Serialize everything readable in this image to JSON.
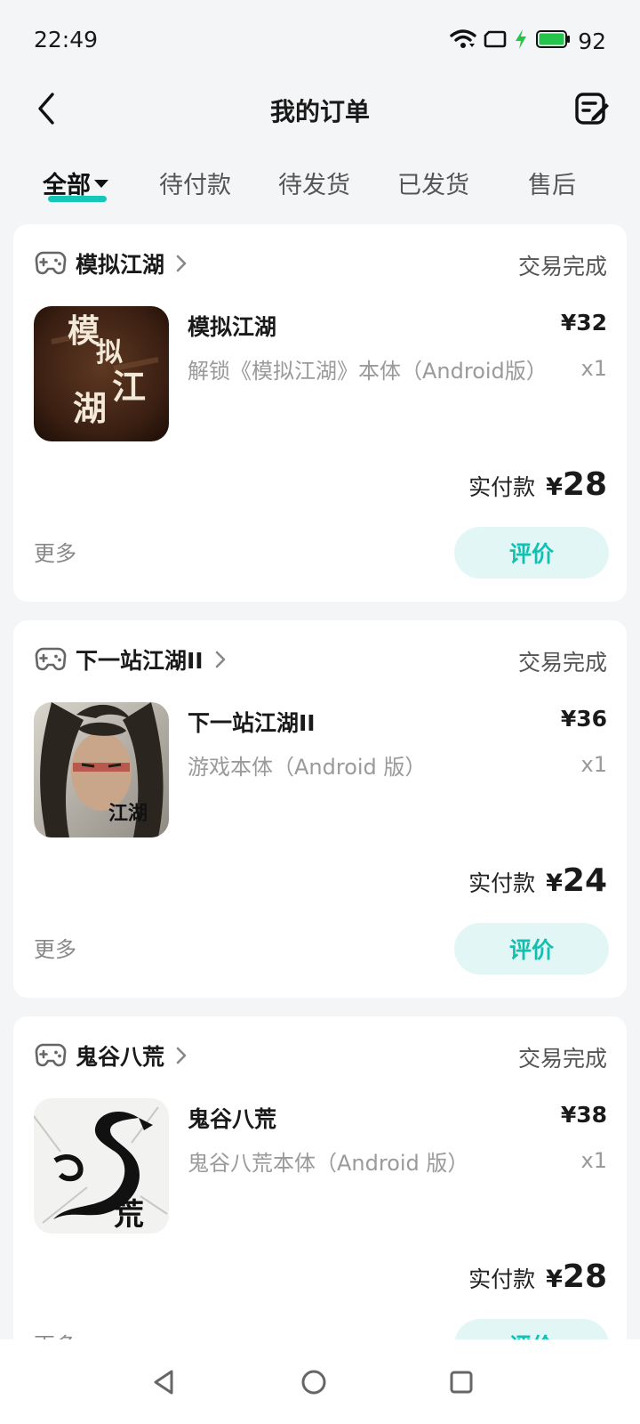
{
  "status_bar": {
    "time": "22:49",
    "battery": "92"
  },
  "header": {
    "title": "我的订单"
  },
  "tabs": [
    {
      "label": "全部",
      "active": true
    },
    {
      "label": "待付款"
    },
    {
      "label": "待发货"
    },
    {
      "label": "已发货"
    },
    {
      "label": "售后"
    }
  ],
  "orders": [
    {
      "store": "模拟江湖",
      "status": "交易完成",
      "product_name": "模拟江湖",
      "price": "¥32",
      "description": "解锁《模拟江湖》本体（Android版）",
      "quantity": "x1",
      "paid_label": "实付款",
      "paid_currency": "¥",
      "paid_amount": "28",
      "more": "更多",
      "action": "评价",
      "icon_text": "模拟江湖"
    },
    {
      "store": "下一站江湖II",
      "status": "交易完成",
      "product_name": "下一站江湖II",
      "price": "¥36",
      "description": "游戏本体（Android 版）",
      "quantity": "x1",
      "paid_label": "实付款",
      "paid_currency": "¥",
      "paid_amount": "24",
      "more": "更多",
      "action": "评价",
      "icon_text": "江湖"
    },
    {
      "store": "鬼谷八荒",
      "status": "交易完成",
      "product_name": "鬼谷八荒",
      "price": "¥38",
      "description": "鬼谷八荒本体（Android 版）",
      "quantity": "x1",
      "paid_label": "实付款",
      "paid_currency": "¥",
      "paid_amount": "28",
      "more": "更多",
      "action": "评价",
      "icon_text": "荒"
    }
  ],
  "colors": {
    "accent": "#14c7b8",
    "action_bg": "#e2f7f5",
    "background": "#f4f5f7"
  },
  "icons": [
    "wifi-icon",
    "screen-icon",
    "charging-icon",
    "battery-icon",
    "back-icon",
    "edit-order-icon",
    "gamepad-icon",
    "chevron-right-icon",
    "nav-back-icon",
    "nav-home-icon",
    "nav-recents-icon"
  ]
}
